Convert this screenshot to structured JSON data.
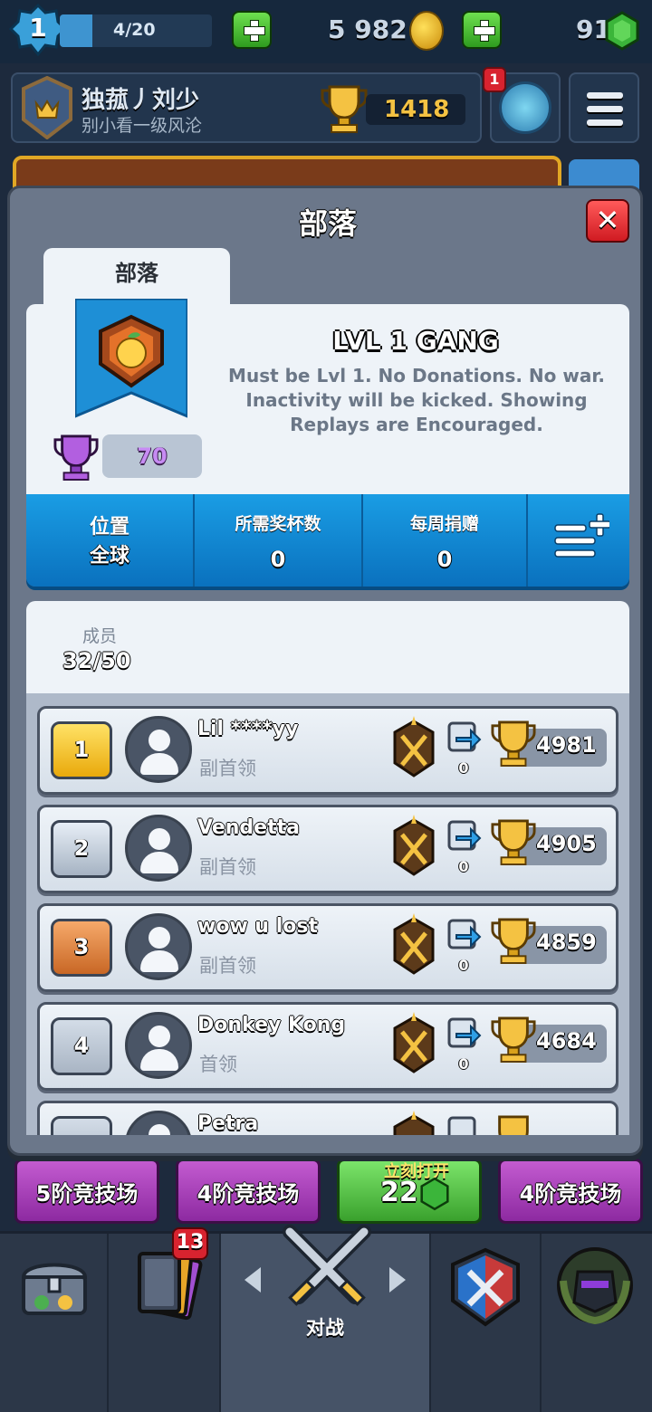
{
  "resources": {
    "level": "1",
    "xp": "4/20",
    "xp_fraction": 0.2,
    "gold": "5 982",
    "gems": "91"
  },
  "profile": {
    "name": "独菰丿刘少",
    "subtitle": "别小看一级风沦",
    "trophies": "1418",
    "notification_count": "1"
  },
  "dialog": {
    "title": "部落",
    "tab_label": "部落"
  },
  "clan": {
    "name": "LVL 1 GANG",
    "description": "Must be Lvl 1. No Donations. No war. Inactivity will be kicked. Showing Replays are Encouraged.",
    "score": "70"
  },
  "stats": {
    "location_label": "位置",
    "location_value": "全球",
    "required_trophies_label": "所需奖杯数",
    "required_trophies_value": "0",
    "weekly_donations_label": "每周捐赠",
    "weekly_donations_value": "0"
  },
  "members": {
    "label": "成员",
    "count": "32/50",
    "list": [
      {
        "rank": "1",
        "name": "Lil ****yy",
        "role": "副首领",
        "donations": "0",
        "trophies": "4981"
      },
      {
        "rank": "2",
        "name": "Vendetta",
        "role": "副首领",
        "donations": "0",
        "trophies": "4905"
      },
      {
        "rank": "3",
        "name": "wow u lost",
        "role": "副首领",
        "donations": "0",
        "trophies": "4859"
      },
      {
        "rank": "4",
        "name": "Donkey Kong",
        "role": "首领",
        "donations": "0",
        "trophies": "4684"
      },
      {
        "rank": "",
        "name": "Petra",
        "role": "",
        "donations": "",
        "trophies": ""
      }
    ]
  },
  "arenas": {
    "left": "5阶竞技场",
    "mid": "4阶竞技场",
    "chest_label": "立刻打开",
    "chest_gem_cost": "22",
    "right": "4阶竞技场"
  },
  "nav": {
    "cards_badge": "13",
    "battle_label": "对战"
  },
  "colors": {
    "accent_blue": "#0a71be",
    "dialog_bg": "#6b778a",
    "gold": "#f4c242",
    "notification_red": "#d8232f"
  }
}
